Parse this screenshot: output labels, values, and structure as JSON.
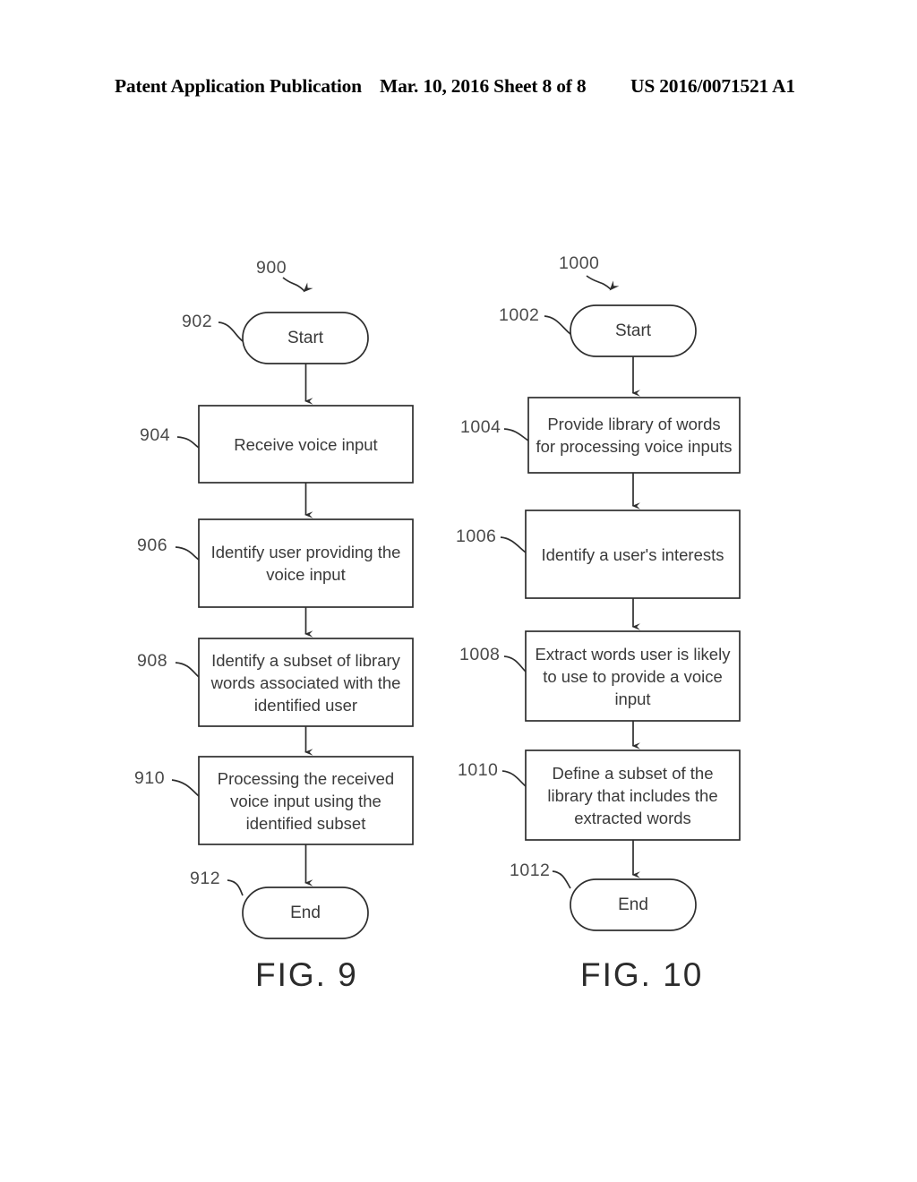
{
  "header": {
    "left": "Patent Application Publication",
    "middle": "Mar. 10, 2016  Sheet 8 of 8",
    "right": "US 2016/0071521 A1"
  },
  "figures": [
    {
      "caption": "FIG. 9",
      "diagram_ref": "900",
      "nodes": [
        {
          "ref": "902",
          "shape": "pill",
          "label": "Start"
        },
        {
          "ref": "904",
          "shape": "rect",
          "label": "Receive voice input"
        },
        {
          "ref": "906",
          "shape": "rect",
          "label": "Identify user providing the voice input"
        },
        {
          "ref": "908",
          "shape": "rect",
          "label": "Identify a subset of library words associated with the identified user"
        },
        {
          "ref": "910",
          "shape": "rect",
          "label": "Processing the received voice input using the identified subset"
        },
        {
          "ref": "912",
          "shape": "pill",
          "label": "End"
        }
      ]
    },
    {
      "caption": "FIG. 10",
      "diagram_ref": "1000",
      "nodes": [
        {
          "ref": "1002",
          "shape": "pill",
          "label": "Start"
        },
        {
          "ref": "1004",
          "shape": "rect",
          "label": "Provide library of words for processing voice inputs"
        },
        {
          "ref": "1006",
          "shape": "rect",
          "label": "Identify a user's interests"
        },
        {
          "ref": "1008",
          "shape": "rect",
          "label": "Extract words user is likely to use to provide a voice input"
        },
        {
          "ref": "1010",
          "shape": "rect",
          "label": "Define a subset of the library that includes the extracted words"
        },
        {
          "ref": "1012",
          "shape": "pill",
          "label": "End"
        }
      ]
    }
  ],
  "style": {
    "stroke": "#2e2e2e",
    "text": "#3a3a3a",
    "background": "#ffffff"
  }
}
